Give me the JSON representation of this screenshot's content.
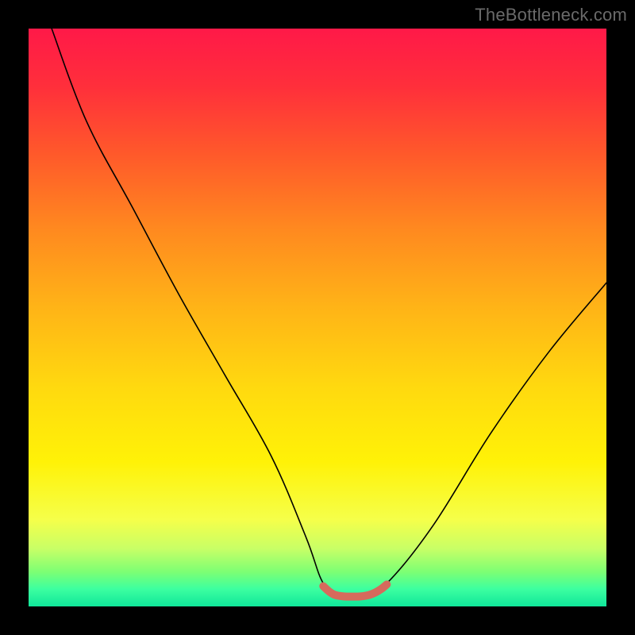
{
  "watermark": "TheBottleneck.com",
  "chart_data": {
    "type": "line",
    "title": "",
    "xlabel": "",
    "ylabel": "",
    "xlim": [
      0,
      100
    ],
    "ylim": [
      0,
      100
    ],
    "grid": false,
    "legend": false,
    "background_gradient": {
      "orientation": "vertical",
      "stops": [
        {
          "pos": 0.0,
          "color": "#ff1948"
        },
        {
          "pos": 0.5,
          "color": "#ffd90f"
        },
        {
          "pos": 0.85,
          "color": "#f5ff4a"
        },
        {
          "pos": 1.0,
          "color": "#10e69a"
        }
      ]
    },
    "series": [
      {
        "name": "main-curve",
        "color": "#000000",
        "stroke_width": 1.6,
        "x": [
          4,
          10,
          18,
          26,
          34,
          42,
          48,
          51,
          54,
          58,
          62,
          70,
          80,
          90,
          100
        ],
        "values": [
          100,
          84,
          69,
          54,
          40,
          26,
          12,
          4,
          2,
          2,
          4,
          14,
          30,
          44,
          56
        ]
      },
      {
        "name": "bottom-band",
        "color": "#d66a5c",
        "stroke_width": 10,
        "x": [
          51,
          52,
          53,
          54,
          55,
          56,
          57,
          58,
          59,
          60,
          61,
          62
        ],
        "values": [
          3.5,
          2.6,
          2.0,
          1.8,
          1.7,
          1.7,
          1.7,
          1.8,
          2.0,
          2.4,
          3.0,
          3.8
        ]
      }
    ]
  }
}
